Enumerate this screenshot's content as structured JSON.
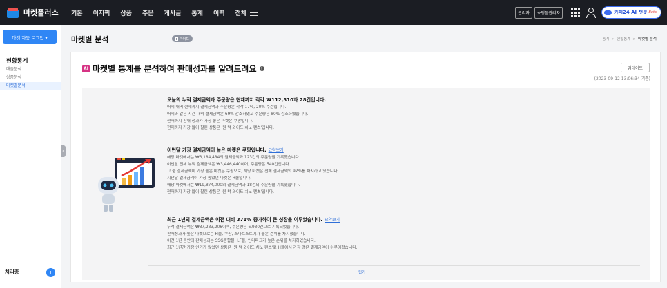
{
  "app": {
    "brand": "마켓플러스"
  },
  "topnav": {
    "items": [
      "기본",
      "이지픽",
      "상품",
      "주문",
      "게시글",
      "통계",
      "이력",
      "전체"
    ],
    "admin_label": "관리자",
    "shop_admin_label": "쇼핑몰관리자",
    "ai_chat_label": "카페24 AI 챗봇",
    "ai_chat_beta": "Beta"
  },
  "sidebar": {
    "auto_login": "마켓 자동 로그인  ▾",
    "section_title": "현황통계",
    "items": [
      {
        "label": "매출분석",
        "active": false
      },
      {
        "label": "상품분석",
        "active": false
      },
      {
        "label": "마켓별분석",
        "active": true
      }
    ],
    "processing_label": "처리중",
    "processing_count": "1"
  },
  "page": {
    "title": "마켓별 분석",
    "guide_label": "가이드",
    "breadcrumb": [
      "통계",
      "현황통계",
      "마켓별 분석"
    ]
  },
  "card": {
    "ai_badge": "AI",
    "title": "마켓별 통계를 분석하여 판매성과를 알려드려요",
    "help": "?",
    "update_label": "업데이트",
    "update_time": "(2023-09-12 13:06:34 기준)",
    "collapse_label": "접기"
  },
  "summary": [
    {
      "heading": "오늘의 누적 결제금액과 주문량은 현재까지 각각 ₩112,310과 28건입니다.",
      "link": "",
      "lines": [
        "어제 대비 현재까지 결제금액과 주문량은 각각 17%, 20% 수준입니다.",
        "어제와 같은 시간 대비 결제금액은 69% 감소하였고 주문량은 80% 감소하였습니다.",
        "현재까지 판매 성과가 가장 좋은 마켓은 쿠팡입니다.",
        "현재까지 가장 많이 팔린 상품은 '원 턱 와이드 치노 팬츠'입니다."
      ]
    },
    {
      "heading": "이번달 가장 결제금액이 높은 마켓은 쿠팡입니다.",
      "link": "요약보기",
      "lines": [
        "해당 마켓에서는 ₩3,184,484의 결제금액과 123건의 주문량을 기록했습니다.",
        "이번달 전체 누적 결제금액은 ₩3,446,440이며, 주문량은 540건입니다.",
        "그 중 결제금액이 가장 높은 마켓은 쿠팡으로, 해당 마켓은 전체 결제금액의 92%를 차지하고 있습니다.",
        "지난달 결제금액이 가장 높았던 마켓은 H몰입니다.",
        "해당 마켓에서는 ₩19,874,000의 결제금액과 18건의 주문량을 기록했습니다.",
        "현재까지 가장 많이 팔린 상품은 '원 턱 와이드 치노 팬츠'입니다."
      ]
    },
    {
      "heading": "최근 1년의 결제금액은 이전 대비 371% 증가하여 큰 성장을 이루었습니다.",
      "link": "요약보기",
      "lines": [
        "누적 결제금액은 ₩37,283,206이며, 주문량은 6,980건으로 기록되었습니다.",
        "판매성과가 높은 마켓으로는 H몰, 쿠팡, 스마트스토어가 높은 순위를 차지했습니다.",
        "이전 1년 동안의 판매성과는 SSG종합몰, LF몰, 인터파크가 높은 순위를 차지하였습니다.",
        "최근 1년간 가장 인기가 많았던 상품은 '원 턱 와이드 치노 팬츠'로 H몰에서 가장 많은 결제금액이 이루어졌습니다."
      ]
    }
  ],
  "colors": {
    "accent": "#2f86f5",
    "topbar": "#1b1d23",
    "ai_badge": "#d63384"
  }
}
